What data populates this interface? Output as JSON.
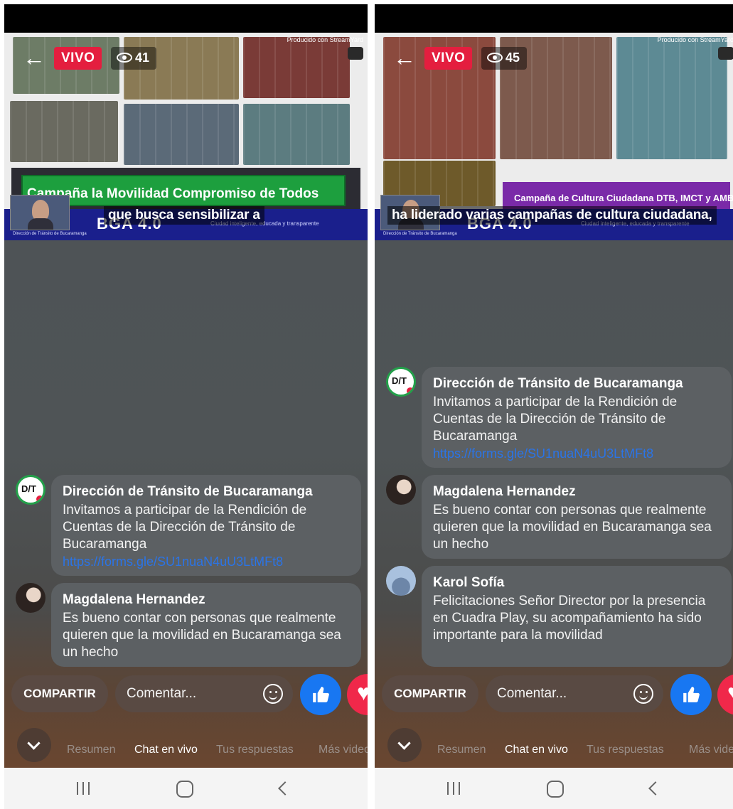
{
  "screens": [
    {
      "live_badge": "VIVO",
      "viewer_count": "41",
      "caption": "que busca sensibilizar a",
      "banner": "Campaña la Movilidad Compromiso de Todos",
      "comments": [
        {
          "author": "Dirección de Tránsito de Bucaramanga",
          "text": "Invitamos a participar de la Rendición de Cuentas de la Dirección de Tránsito de Bucaramanga",
          "link": "https://forms.gle/SU1nuaN4uU3LtMFt8"
        },
        {
          "author": "Magdalena Hernandez",
          "text": "Es bueno contar con personas que realmente quieren que la movilidad en Bucaramanga sea un hecho"
        }
      ]
    },
    {
      "live_badge": "VIVO",
      "viewer_count": "45",
      "caption": "ha liderado varias campañas de cultura ciudadana,",
      "banner": "Campaña de Cultura Ciudadana DTB, IMCT y AMB",
      "comments": [
        {
          "author": "Dirección de Tránsito de Bucaramanga",
          "text": "Invitamos a participar de la Rendición de Cuentas de la Dirección de Tránsito de Bucaramanga",
          "link": "https://forms.gle/SU1nuaN4uU3LtMFt8"
        },
        {
          "author": "Magdalena Hernandez",
          "text": "Es bueno contar con personas que realmente quieren que la movilidad en Bucaramanga sea un hecho"
        },
        {
          "author": "Karol Sofía",
          "text": "Felicitaciones Señor Director por la presencia en Cuadra Play, su acompañamiento ha sido importante para la movilidad"
        }
      ]
    }
  ],
  "actions": {
    "share_label": "COMPARTIR",
    "comment_placeholder": "Comentar..."
  },
  "tabs": [
    "Resumen",
    "Chat en vivo",
    "Tus respuestas",
    "Más videos"
  ],
  "active_tab": "Chat en vivo",
  "overlay": {
    "brand": "BGA 4.0",
    "tagline": "Ciudad inteligente, educada y transparente",
    "org_footer": "Dirección de Tránsito de Bucaramanga",
    "stream_label": "Producido con StreamYard"
  },
  "colors": {
    "live_red": "#e41e3f",
    "like_blue": "#1877f2",
    "love_red": "#f0284a",
    "link_blue": "#2b74e6",
    "overlay_blue": "#1a1f8c"
  }
}
